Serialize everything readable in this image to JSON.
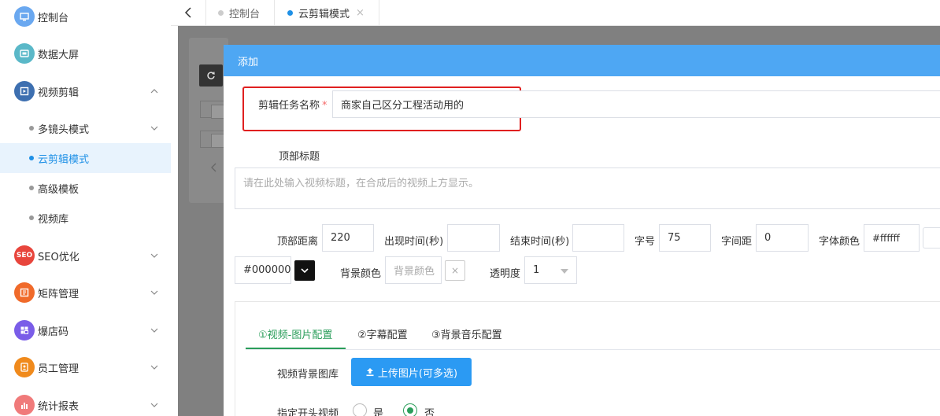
{
  "sidebar": {
    "items": [
      {
        "label": "控制台",
        "icon": "monitor-icon",
        "color": "#6aa8f0"
      },
      {
        "label": "数据大屏",
        "icon": "screen-icon",
        "color": "#5ab8c8"
      },
      {
        "label": "视频剪辑",
        "icon": "video-edit-icon",
        "color": "#3d6fb0"
      },
      {
        "label": "SEO优化",
        "icon": "seo-icon",
        "color": "#e8453c"
      },
      {
        "label": "矩阵管理",
        "icon": "matrix-icon",
        "color": "#f06a2a"
      },
      {
        "label": "爆店码",
        "icon": "grid-icon",
        "color": "#7a5de8"
      },
      {
        "label": "员工管理",
        "icon": "staff-icon",
        "color": "#f08a1c"
      },
      {
        "label": "统计报表",
        "icon": "chart-icon",
        "color": "#f07a7a"
      }
    ],
    "sub_items": [
      {
        "label": "多镜头模式"
      },
      {
        "label": "云剪辑模式"
      },
      {
        "label": "高级模板"
      },
      {
        "label": "视频库"
      }
    ],
    "seo_icon_text": "SEO"
  },
  "tabs": [
    {
      "label": "控制台",
      "dot_color": "#cccccc"
    },
    {
      "label": "云剪辑模式",
      "dot_color": "#1e90e6",
      "close": "×"
    }
  ],
  "modal": {
    "title": "添加",
    "task_name_label": "剪辑任务名称",
    "required_mark": "*",
    "task_name_value": "商家自己区分工程活动用的",
    "top_title_label": "顶部标题",
    "top_title_placeholder": "请在此处输入视频标题，在合成后的视频上方显示。",
    "top_distance_label": "顶部距离",
    "top_distance_value": "220",
    "show_time_label": "出现时间(秒)",
    "end_time_label": "结束时间(秒)",
    "font_size_label": "字号",
    "font_size_value": "75",
    "letter_spacing_label": "字间距",
    "letter_spacing_value": "0",
    "font_color_label": "字体颜色",
    "font_color_value": "#ffffff",
    "stroke_color_value": "#000000",
    "bg_color_label": "背景颜色",
    "bg_color_placeholder": "背景颜色",
    "clear_icon": "×",
    "opacity_label": "透明度",
    "opacity_value": "1",
    "sub_tabs": [
      "①视频-图片配置",
      "②字幕配置",
      "③背景音乐配置"
    ],
    "bg_gallery_label": "视频背景图库",
    "upload_button": "上传图片(可多选)",
    "opening_video_label": "指定开头视频",
    "radio_yes": "是",
    "radio_no": "否"
  }
}
